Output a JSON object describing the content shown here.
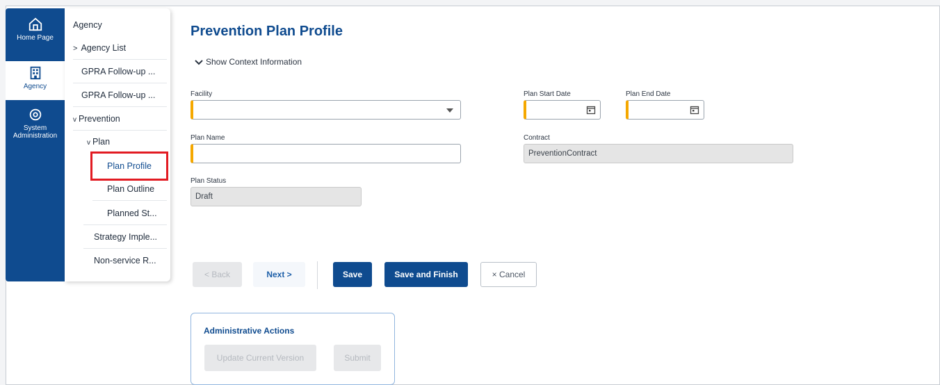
{
  "rail": {
    "items": [
      {
        "label": "Home Page",
        "icon": "home-icon"
      },
      {
        "label": "Agency",
        "icon": "building-icon"
      },
      {
        "label": "System Administration",
        "icon": "settings-icon"
      }
    ]
  },
  "nav": {
    "agency": "Agency",
    "agency_list": "Agency List",
    "gpra1": "GPRA Follow-up ...",
    "gpra2": "GPRA Follow-up ...",
    "prevention": "Prevention",
    "plan": "Plan",
    "plan_profile": "Plan Profile",
    "plan_outline": "Plan Outline",
    "planned_st": "Planned St...",
    "strategy": "Strategy Imple...",
    "nonservice": "Non-service R...",
    "chevron_right": ">",
    "chevron_down": "v"
  },
  "page": {
    "title": "Prevention Plan Profile",
    "context_toggle": "Show Context Information"
  },
  "form": {
    "facility_label": "Facility",
    "facility_value": "",
    "plan_start_label": "Plan Start Date",
    "plan_end_label": "Plan End Date",
    "plan_name_label": "Plan Name",
    "plan_name_value": "",
    "contract_label": "Contract",
    "contract_value": "PreventionContract",
    "plan_status_label": "Plan Status",
    "plan_status_value": "Draft"
  },
  "actions": {
    "back": "< Back",
    "next": "Next >",
    "save": "Save",
    "save_finish": "Save and Finish",
    "cancel": "× Cancel"
  },
  "admin": {
    "title": "Administrative Actions",
    "update_version": "Update Current Version",
    "submit": "Submit"
  },
  "colors": {
    "brand": "#0f4b8f",
    "required": "#f5a800",
    "highlight": "#e21b22"
  }
}
